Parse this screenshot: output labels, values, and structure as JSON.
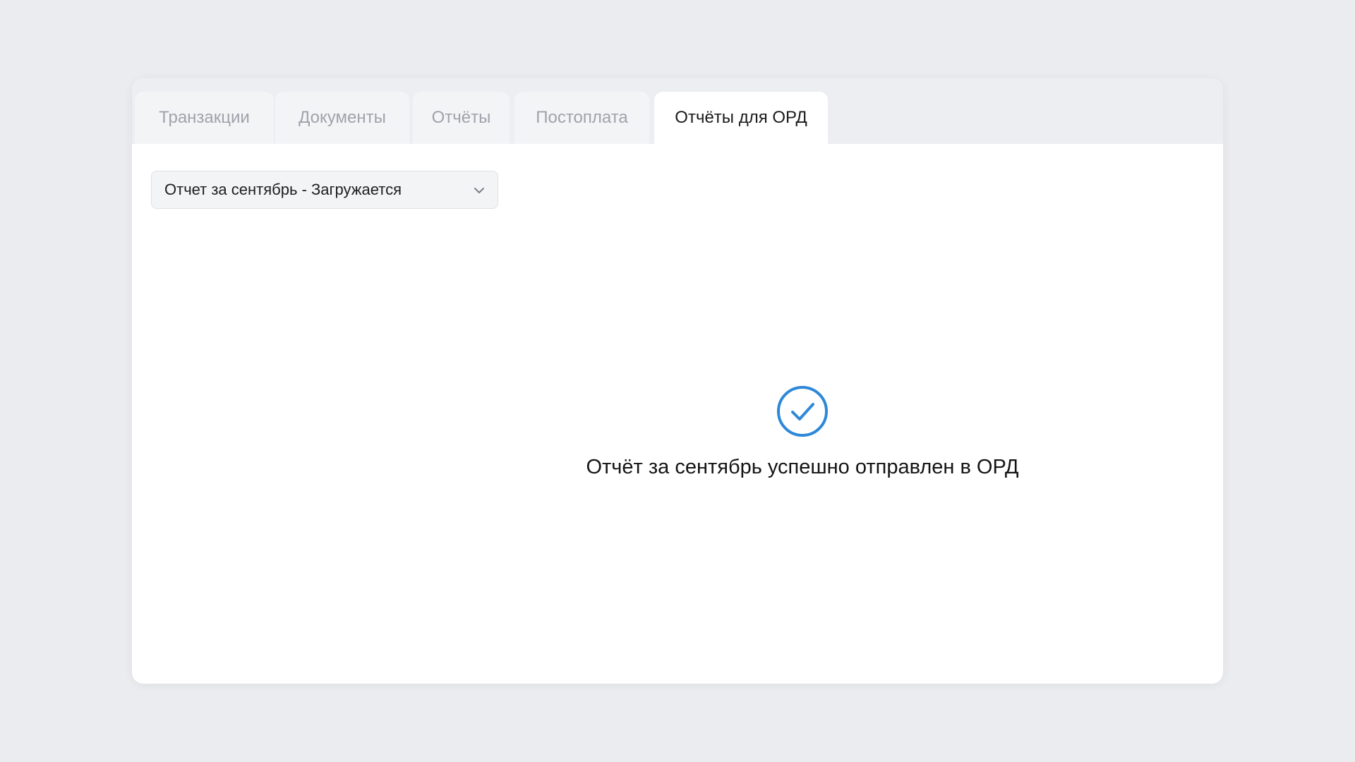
{
  "tabs": [
    {
      "label": "Транзакции",
      "active": false
    },
    {
      "label": "Документы",
      "active": false
    },
    {
      "label": "Отчёты",
      "active": false
    },
    {
      "label": "Постоплата",
      "active": false
    },
    {
      "label": "Отчёты для ОРД",
      "active": true
    }
  ],
  "report_select": {
    "value": "Отчет за сентябрь - Загружается",
    "icon": "chevron-down-icon"
  },
  "status": {
    "icon": "check-circle-icon",
    "message": "Отчёт за сентябрь успешно отправлен в ОРД",
    "icon_color": "#2d88d8"
  }
}
